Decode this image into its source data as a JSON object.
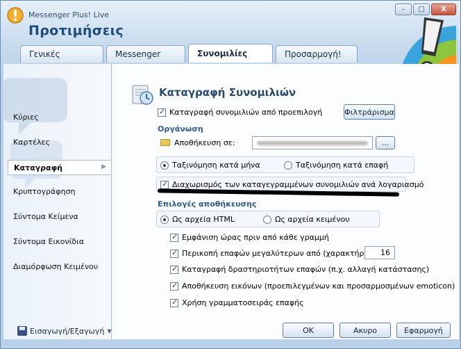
{
  "window": {
    "app_name": "Messenger Plus! Live",
    "title": "Προτιμήσεις",
    "minimize_glyph": "–",
    "maximize_glyph": "□",
    "close_glyph": "X"
  },
  "tabs": [
    {
      "label": "Γενικές",
      "active": false
    },
    {
      "label": "Messenger",
      "active": false
    },
    {
      "label": "Συνομιλίες",
      "active": true
    },
    {
      "label": "Προσαρμογή!",
      "active": false
    }
  ],
  "sidebar": {
    "items": [
      {
        "label": "Κύριες",
        "active": false
      },
      {
        "label": "Καρτέλες",
        "active": false
      },
      {
        "label": "Καταγραφή",
        "active": true
      },
      {
        "label": "Κρυπτογράφηση",
        "active": false
      },
      {
        "label": "Σύντομα Κείμενα",
        "active": false
      },
      {
        "label": "Σύντομα Εικονίδια",
        "active": false
      },
      {
        "label": "Διαμόρφωση Κειμένου",
        "active": false
      }
    ],
    "import_export_label": "Εισαγωγή/Εξαγωγή"
  },
  "section": {
    "title": "Καταγραφή Συνομιλιών",
    "log_default": {
      "label": "Καταγραφή συνομιλιών από προεπιλογή",
      "checked": true
    },
    "filter_button": "Φιλτράρισμα",
    "organization_label": "Οργάνωση",
    "save_in_label": "Αποθήκευση σε:",
    "browse_button": "...",
    "sort_month": {
      "label": "Ταξινόμηση κατά μήνα",
      "checked": true
    },
    "sort_contact": {
      "label": "Ταξινόμηση κατά επαφή",
      "checked": false
    },
    "separate_accounts": {
      "label": "Διαχωρισμός των καταγεγραμμένων συνομιλιών ανά λογαριασμό",
      "checked": true
    },
    "save_options_label": "Επιλογές αποθήκευσης",
    "format_html": {
      "label": "Ως αρχεία HTML",
      "checked": true
    },
    "format_text": {
      "label": "Ως αρχεία κειμένου",
      "checked": false
    },
    "show_time": {
      "label": "Εμφάνιση ώρας πριν από κάθε γραμμή",
      "checked": true
    },
    "truncate_names": {
      "label": "Περικοπή επαφών μεγαλύτερων από (χαρακτήρες):",
      "checked": true,
      "value": "16"
    },
    "log_activity": {
      "label": "Καταγραφή δραστηριοτήτων επαφών  (π.χ. αλλαγή κατάστασης)",
      "checked": true
    },
    "save_images": {
      "label": "Αποθήκευση εικόνων (προεπιλεγμένων και προσαρμοσμένων emoticon)",
      "checked": true
    },
    "contact_font": {
      "label": "Χρήση γραμματοσειράς επαφής",
      "checked": true
    }
  },
  "footer": {
    "ok": "ΟΚ",
    "cancel": "Ακυρο",
    "apply": "Εφαρμογή"
  },
  "colors": {
    "accent": "#1e4b7e",
    "group_label": "#2e5b8a"
  }
}
